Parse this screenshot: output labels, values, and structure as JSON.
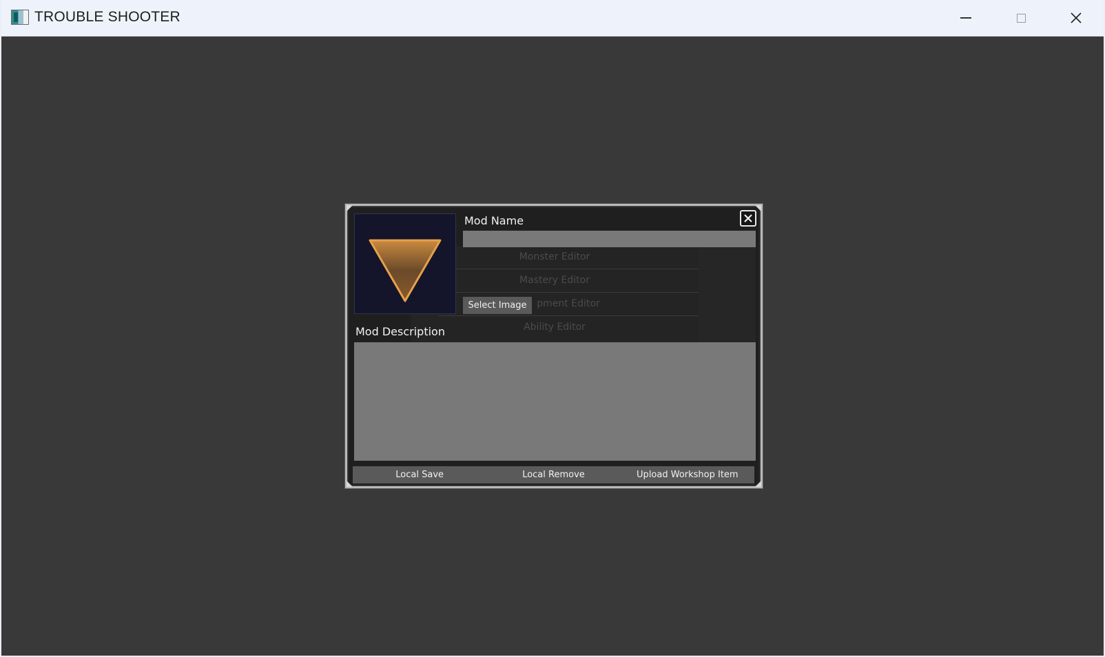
{
  "window": {
    "title": "TROUBLE SHOOTER"
  },
  "dialog": {
    "mod_name_label": "Mod Name",
    "mod_name_value": "",
    "mod_description_label": "Mod Description",
    "mod_description_value": "",
    "select_image_label": "Select Image",
    "preview_icon": "inverted-triangle-icon",
    "buttons": {
      "local_save": "Local Save",
      "local_remove": "Local Remove",
      "upload_workshop_item": "Upload Workshop Item"
    }
  },
  "background_menu": {
    "items": [
      {
        "label": "Monster Editor"
      },
      {
        "label": "Mastery Editor"
      },
      {
        "label": "pment Editor"
      },
      {
        "label": "Ability Editor"
      }
    ]
  },
  "colors": {
    "window_background": "#393939",
    "dialog_background": "#1f1f1f",
    "input_background": "#7a797a",
    "button_background": "#5a5a5a",
    "triangle_accent": "#d18a3a"
  }
}
